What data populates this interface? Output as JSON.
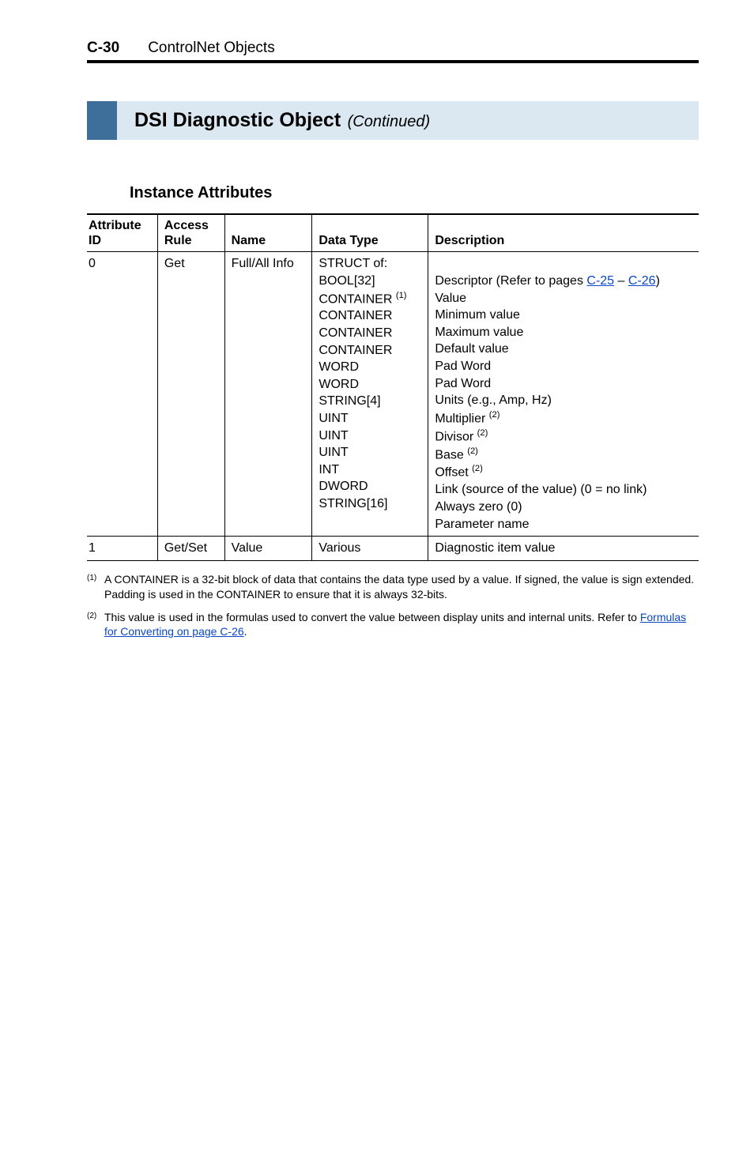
{
  "header": {
    "page_num": "C-30",
    "chapter": "ControlNet Objects"
  },
  "section": {
    "title": "DSI Diagnostic Object",
    "cont": "(Continued)"
  },
  "subhead": "Instance Attributes",
  "table": {
    "headers": {
      "attr_id_line1": "Attribute",
      "attr_id_line2": "ID",
      "access_line1": "Access",
      "access_line2": "Rule",
      "name": "Name",
      "data_type": "Data Type",
      "description": "Description"
    },
    "row0": {
      "attr_id": "0",
      "access": "Get",
      "name": "Full/All Info",
      "data_type_lines": {
        "l0": "STRUCT of:",
        "l1": "BOOL[32]",
        "l2a": "CONTAINER ",
        "l2b": "(1)",
        "l3": "CONTAINER",
        "l4": "CONTAINER",
        "l5": "CONTAINER",
        "l6": "WORD",
        "l7": "WORD",
        "l8": "STRING[4]",
        "l9": "UINT",
        "l10": "UINT",
        "l11": "UINT",
        "l12": "INT",
        "l13": "DWORD",
        "l14": "STRING[16]"
      },
      "desc_lines": {
        "l0": "",
        "l1a": "Descriptor (Refer to pages ",
        "l1b": "C-25",
        "l1c": " – ",
        "l1d": "C-26",
        "l1e": ")",
        "l2": "Value",
        "l3": "Minimum value",
        "l4": "Maximum value",
        "l5": "Default value",
        "l6": "Pad Word",
        "l7": "Pad Word",
        "l8": "Units (e.g., Amp, Hz)",
        "l9a": "Multiplier ",
        "l9b": "(2)",
        "l10a": "Divisor ",
        "l10b": "(2)",
        "l11a": "Base ",
        "l11b": "(2)",
        "l12a": "Offset ",
        "l12b": "(2)",
        "l13": "Link (source of the value) (0 = no link)",
        "l14": "Always zero (0)",
        "l15": "Parameter name"
      }
    },
    "row1": {
      "attr_id": "1",
      "access": "Get/Set",
      "name": "Value",
      "data_type": "Various",
      "description": "Diagnostic item value"
    }
  },
  "footnotes": {
    "f1_num": "(1)",
    "f1_text": "A CONTAINER is a 32-bit block of data that contains the data type used by a value. If signed, the value is sign extended. Padding is used in the CONTAINER to ensure that it is always 32-bits.",
    "f2_num": "(2)",
    "f2_text_a": "This value is used in the formulas used to convert the value between display units and internal units. Refer to ",
    "f2_link": "Formulas for Converting on page C-26",
    "f2_text_b": "."
  }
}
